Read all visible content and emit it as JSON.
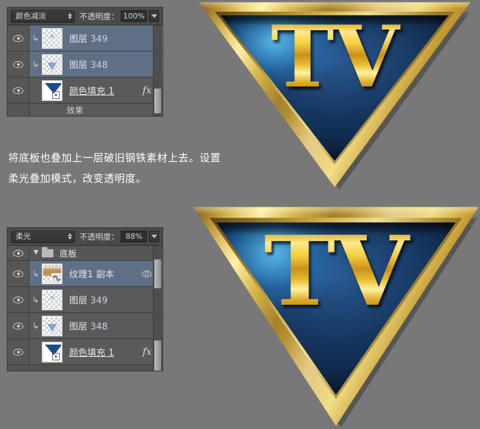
{
  "background_color": "#787878",
  "caption": {
    "line1": "将底板也叠加上一层破旧钢铁素材上去。设置",
    "line2": "柔光叠加模式，改变透明度。"
  },
  "panel_top": {
    "blend_mode": "颜色减淡",
    "opacity_label": "不透明度：",
    "opacity_value": "100%",
    "rows": [
      {
        "name": "图层",
        "num": "349",
        "kind": "layer",
        "selected": true,
        "clipped": true,
        "visible": true,
        "thumb": "transparent-dot"
      },
      {
        "name": "图层",
        "num": "348",
        "kind": "layer",
        "selected": true,
        "clipped": true,
        "visible": true,
        "thumb": "transparent-v"
      },
      {
        "name": "颜色填充 1",
        "num": "",
        "kind": "fill",
        "selected": false,
        "clipped": false,
        "visible": true,
        "thumb": "blue-fill",
        "fx": "fx"
      },
      {
        "name": "效果",
        "num": "",
        "kind": "partial",
        "selected": false,
        "clipped": false,
        "visible": true,
        "thumb": ""
      }
    ]
  },
  "panel_bottom": {
    "blend_mode": "柔光",
    "opacity_label": "不透明度：",
    "opacity_value": "88%",
    "group": {
      "name": "底板",
      "expanded": true,
      "visible": true
    },
    "rows": [
      {
        "name": "纹理1 副本",
        "num": "",
        "kind": "layer",
        "selected": true,
        "clipped": true,
        "visible": true,
        "thumb": "texture",
        "mask": true
      },
      {
        "name": "图层",
        "num": "349",
        "kind": "layer",
        "selected": false,
        "clipped": true,
        "visible": true,
        "thumb": "transparent-dot"
      },
      {
        "name": "图层",
        "num": "348",
        "kind": "layer",
        "selected": false,
        "clipped": true,
        "visible": true,
        "thumb": "transparent-v"
      },
      {
        "name": "颜色填充 1",
        "num": "",
        "kind": "fill",
        "selected": false,
        "clipped": false,
        "visible": true,
        "thumb": "blue-fill",
        "fx": "fx"
      }
    ]
  },
  "logos": [
    {
      "id": "logo-top",
      "text": "TV",
      "frame_color": "#c9a33c",
      "inner_color": "#123257"
    },
    {
      "id": "logo-bottom",
      "text": "TV",
      "frame_color": "#c9a33c",
      "inner_color": "#123257"
    }
  ]
}
